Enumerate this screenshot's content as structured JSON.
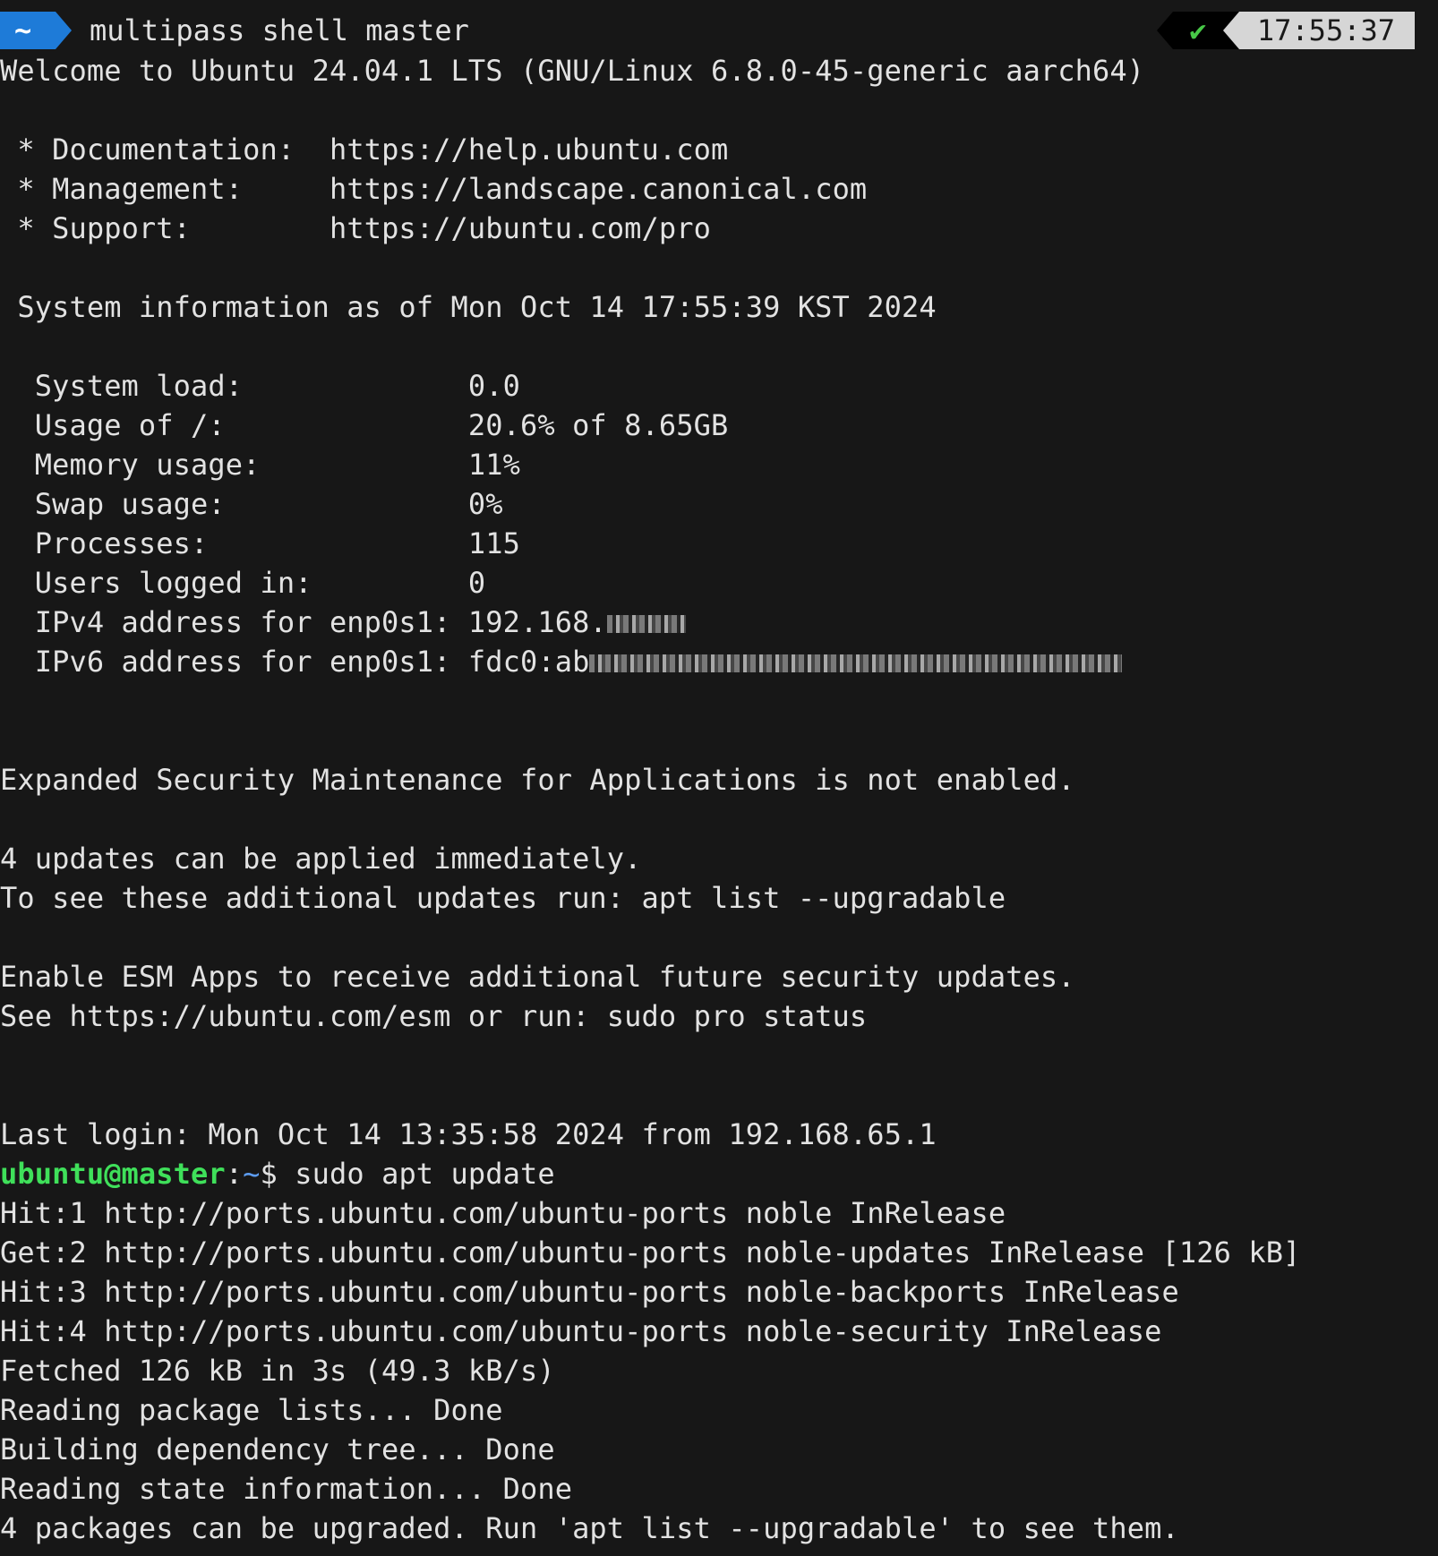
{
  "prompt": {
    "segment_label": "~",
    "command": "multipass shell master",
    "status_icon": "check-icon",
    "status_check": "✔",
    "time": "17:55:37"
  },
  "motd": {
    "welcome": "Welcome to Ubuntu 24.04.1 LTS (GNU/Linux 6.8.0-45-generic aarch64)",
    "links": [
      {
        "bullet": " * ",
        "label": "Documentation:  ",
        "url": "https://help.ubuntu.com"
      },
      {
        "bullet": " * ",
        "label": "Management:     ",
        "url": "https://landscape.canonical.com"
      },
      {
        "bullet": " * ",
        "label": "Support:        ",
        "url": "https://ubuntu.com/pro"
      }
    ],
    "sysinfo_header": " System information as of Mon Oct 14 17:55:39 KST 2024",
    "sysinfo": [
      {
        "label": "  System load:             ",
        "value": "0.0"
      },
      {
        "label": "  Usage of /:              ",
        "value": "20.6% of 8.65GB"
      },
      {
        "label": "  Memory usage:            ",
        "value": "11%"
      },
      {
        "label": "  Swap usage:              ",
        "value": "0%"
      },
      {
        "label": "  Processes:               ",
        "value": "115"
      },
      {
        "label": "  Users logged in:         ",
        "value": "0"
      },
      {
        "label": "  IPv4 address for enp0s1: ",
        "value": "192.168."
      },
      {
        "label": "  IPv6 address for enp0s1: ",
        "value": "fdc0:ab"
      }
    ],
    "esm_notice": "Expanded Security Maintenance for Applications is not enabled.",
    "updates_line1": "4 updates can be applied immediately.",
    "updates_line2": "To see these additional updates run: apt list --upgradable",
    "esm_line1": "Enable ESM Apps to receive additional future security updates.",
    "esm_line2": "See https://ubuntu.com/esm or run: sudo pro status",
    "last_login": "Last login: Mon Oct 14 13:35:58 2024 from 192.168.65.1"
  },
  "shell": {
    "user_host": "ubuntu@master",
    "colon": ":",
    "cwd": "~",
    "dollar": "$ ",
    "command": "sudo apt update"
  },
  "output": [
    "Hit:1 http://ports.ubuntu.com/ubuntu-ports noble InRelease",
    "Get:2 http://ports.ubuntu.com/ubuntu-ports noble-updates InRelease [126 kB]",
    "Hit:3 http://ports.ubuntu.com/ubuntu-ports noble-backports InRelease",
    "Hit:4 http://ports.ubuntu.com/ubuntu-ports noble-security InRelease",
    "Fetched 126 kB in 3s (49.3 kB/s)",
    "Reading package lists... Done",
    "Building dependency tree... Done",
    "Reading state information... Done",
    "4 packages can be upgraded. Run 'apt list --upgradable' to see them."
  ],
  "colors": {
    "background": "#171717",
    "text": "#e2e2e2",
    "prompt_segment": "#1e7bd8",
    "user_host": "#3fe05a",
    "cwd": "#5d9cf0",
    "status_ok": "#47c847"
  }
}
